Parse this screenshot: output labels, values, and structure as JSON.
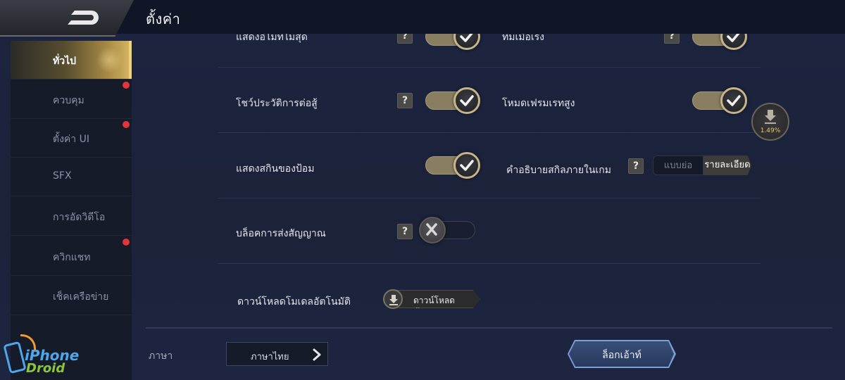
{
  "header": {
    "title": "ตั้งค่า",
    "back_icon": "back-arrow-icon"
  },
  "sidebar": {
    "items": [
      {
        "label": "ทั่วไป",
        "active": true,
        "badge": false
      },
      {
        "label": "ควบคุม",
        "active": false,
        "badge": true
      },
      {
        "label": "ตั้งค่า UI",
        "active": false,
        "badge": true
      },
      {
        "label": "SFX",
        "active": false,
        "badge": false
      },
      {
        "label": "การอัดวิดีโอ",
        "active": false,
        "badge": false
      },
      {
        "label": "ควิกแชท",
        "active": false,
        "badge": true
      },
      {
        "label": "เช็คเครือข่าย",
        "active": false,
        "badge": false
      }
    ],
    "badge_color": "#e0363c"
  },
  "settings": {
    "partial_left": {
      "label": "แสดงอีโมทีไม่สุด",
      "on": true
    },
    "partial_right": {
      "label": "ทีมเมือเรง",
      "on": true
    },
    "battle_history": {
      "label": "โชว์ประวัติการต่อสู้",
      "help": "?",
      "on": true
    },
    "high_frame": {
      "label": "โหมดเฟรมเรทสูง",
      "on": true
    },
    "skin_tower": {
      "label": "แสดงสกินของป้อม",
      "on": true
    },
    "skill_desc": {
      "label": "คำอธิบายสกิลภายในเกม",
      "help": "?",
      "options": [
        "แบบย่อ",
        "รายละเอียด"
      ],
      "selected": "รายละเอียด"
    },
    "block_signal": {
      "label": "บล็อคการส่งสัญญาณ",
      "help": "?",
      "on": false
    },
    "auto_download": {
      "label": "ดาวน์โหลดโมเดลอัตโนมัติ",
      "button": "ดาวน์โหลดทั้งหมด"
    }
  },
  "download_progress": {
    "percent_text": "1.49%",
    "percent": 1.49
  },
  "footer": {
    "language_label": "ภาษา",
    "language_value": "ภาษาไทย",
    "logout": "ล็อกเอ้าท์"
  },
  "watermark": {
    "brand_top": "iPhone",
    "brand_bottom": "Droid"
  },
  "colors": {
    "accent_gold": "#c6b58a",
    "panel_bg": "#1b2239",
    "logout_blue": "#3a507a"
  }
}
